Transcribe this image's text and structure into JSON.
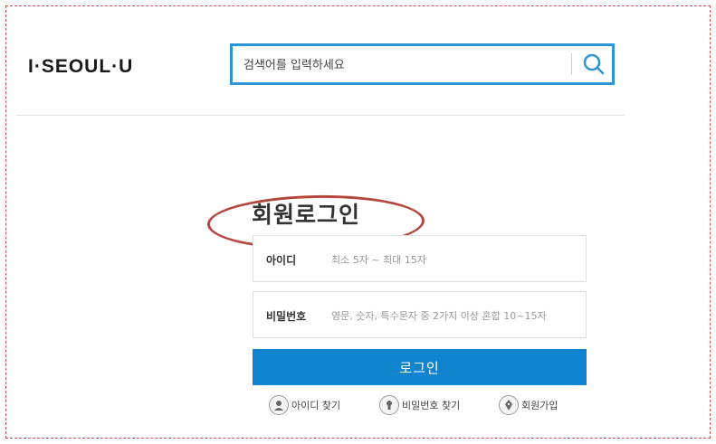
{
  "header": {
    "logo": "I·SEOUL·U",
    "search": {
      "placeholder": "검색어를 입력하세요"
    }
  },
  "login": {
    "title": "회원로그인",
    "id_label": "아이디",
    "id_placeholder": "최소 5자 ~ 최대 15자",
    "password_label": "비밀번호",
    "password_placeholder": "영문, 숫자, 특수문자 중 2가지 이상 혼합 10~15자",
    "submit_label": "로그인"
  },
  "links": {
    "find_id": "아이디 찾기",
    "find_password": "비밀번호 찾기",
    "signup": "회원가입"
  },
  "colors": {
    "accent": "#1184d0",
    "search_border": "#2b95d6",
    "annotation": "#b5463e"
  }
}
